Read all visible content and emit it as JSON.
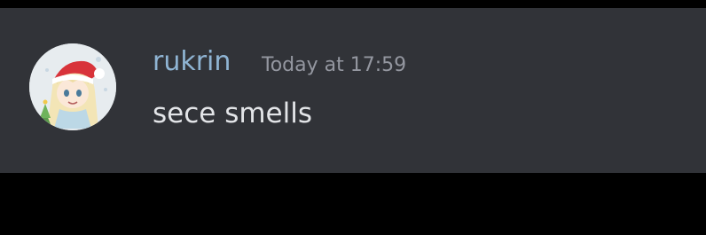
{
  "message": {
    "author": "rukrin",
    "timestamp": "Today at 17:59",
    "content": "sece smells",
    "avatar_icon": "user-avatar-icon"
  },
  "colors": {
    "message_background": "#313338",
    "outer_background": "#000000",
    "username": "#8fb4d3",
    "timestamp": "#9497a0",
    "message_text": "#e3e5e8"
  }
}
